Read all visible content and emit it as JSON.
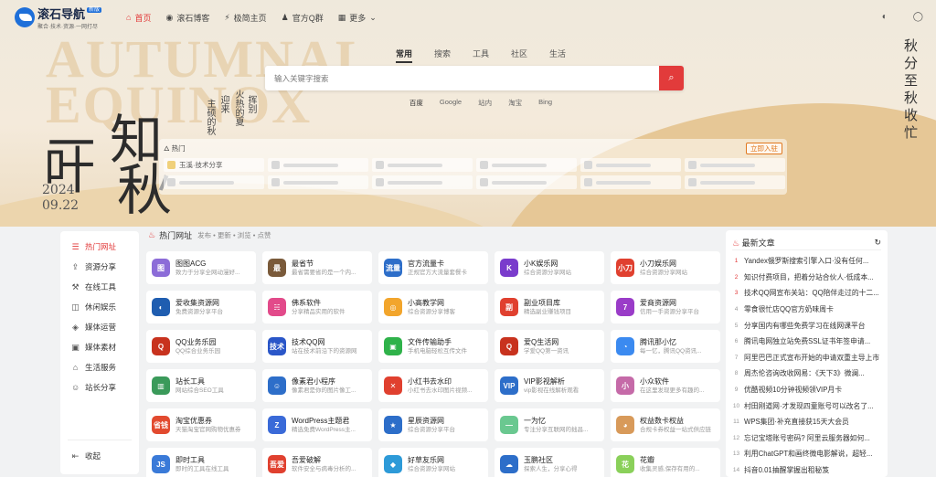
{
  "header": {
    "logo_title": "滚石导航",
    "logo_badge": "新版",
    "logo_slogan": "聚合·技术·资源·一网打尽",
    "nav": [
      {
        "label": "首页",
        "icon": "home-icon",
        "active": true
      },
      {
        "label": "滚石博客",
        "icon": "globe-icon",
        "active": false
      },
      {
        "label": "极简主页",
        "icon": "bolt-icon",
        "active": false
      },
      {
        "label": "官方Q群",
        "icon": "qq-penguin-icon",
        "active": false
      },
      {
        "label": "更多",
        "icon": "grid-icon",
        "active": false
      }
    ]
  },
  "hero": {
    "watermark": [
      "AUTUMNAL",
      "EQUINOX"
    ],
    "big_char_1": "一",
    "big_char_2": "叶",
    "big_char_3": "知",
    "big_char_4": "秋",
    "poem_col_1": "主硕的秋",
    "poem_col_2": "迎来",
    "poem_col_3": "火热的夏",
    "poem_col_4": "挥别",
    "year": "2024",
    "date": "09.22",
    "right_text_1": "秋分至",
    "right_text_2": "秋收忙"
  },
  "search": {
    "tabs": [
      "常用",
      "搜索",
      "工具",
      "社区",
      "生活"
    ],
    "active_tab": 0,
    "placeholder": "输入关键字搜索",
    "engines": [
      "百度",
      "Google",
      "站内",
      "淘宝",
      "Bing"
    ],
    "active_engine": 0
  },
  "hot": {
    "title": "热门",
    "join_label": "立即入驻",
    "first_item": "玉溪·技术分享"
  },
  "sidebar": {
    "items": [
      {
        "label": "热门网址",
        "icon": "list-icon",
        "active": true
      },
      {
        "label": "资源分享",
        "icon": "share-icon",
        "active": false
      },
      {
        "label": "在线工具",
        "icon": "tools-icon",
        "active": false
      },
      {
        "label": "休闲娱乐",
        "icon": "gamepad-icon",
        "active": false
      },
      {
        "label": "媒体运营",
        "icon": "layers-icon",
        "active": false
      },
      {
        "label": "媒体素材",
        "icon": "image-icon",
        "active": false
      },
      {
        "label": "生活服务",
        "icon": "store-icon",
        "active": false
      },
      {
        "label": "站长分享",
        "icon": "user-icon",
        "active": false
      }
    ],
    "collapse_label": "收起"
  },
  "section": {
    "title": "热门网址",
    "subtitle": "发布 • 更新 • 浏览 • 点赞"
  },
  "sites": [
    {
      "name": "图图ACG",
      "desc": "致力于分享全网动漫好...",
      "color": "#8c6cd8",
      "g": "图"
    },
    {
      "name": "最省节",
      "desc": "最省需要省的是一个内...",
      "color": "#7a5a3a",
      "g": "最"
    },
    {
      "name": "官方流量卡",
      "desc": "正规官方大流量套餐卡",
      "color": "#2d6ec9",
      "g": "流量"
    },
    {
      "name": "小K娱乐网",
      "desc": "综合资源分享网站",
      "color": "#7a3ccc",
      "g": "K"
    },
    {
      "name": "小刀娱乐网",
      "desc": "综合资源分享网站",
      "color": "#e0402f",
      "g": "小刀"
    },
    {
      "name": "爱收集资源网",
      "desc": "免费资源分享平台",
      "color": "#1f5db0",
      "g": "◐"
    },
    {
      "name": "佛系软件",
      "desc": "分享精品实用的软件",
      "color": "#e24a8a",
      "g": "☵"
    },
    {
      "name": "小高教学网",
      "desc": "综合资源分享博客",
      "color": "#f2a52c",
      "g": "◎"
    },
    {
      "name": "副业项目库",
      "desc": "精选副业赚钱项目",
      "color": "#e0402f",
      "g": "副"
    },
    {
      "name": "爱商资源网",
      "desc": "信用一手资源分享平台",
      "color": "#9a3cc8",
      "g": "7"
    },
    {
      "name": "QQ业务乐园",
      "desc": "QQ综合业务乐园",
      "color": "#c8321e",
      "g": "Q"
    },
    {
      "name": "技术QQ网",
      "desc": "站在技术前沿下的资源网",
      "color": "#2a56c8",
      "g": "技术"
    },
    {
      "name": "文件传输助手",
      "desc": "手机电脑轻松互传文件",
      "color": "#2fb24a",
      "g": "▣"
    },
    {
      "name": "爱Q生活网",
      "desc": "学爱QQ第一资讯",
      "color": "#c8321e",
      "g": "Q"
    },
    {
      "name": "腾讯那小忆",
      "desc": "每一忆，腾讯QQ资讯...",
      "color": "#3b8af0",
      "g": "◔"
    },
    {
      "name": "站长工具",
      "desc": "网站综合SEO工具",
      "color": "#3a9a5a",
      "g": "▥"
    },
    {
      "name": "像素君小程序",
      "desc": "像素君是你的图片像工...",
      "color": "#2d6ec9",
      "g": "☺"
    },
    {
      "name": "小红书去水印",
      "desc": "小红书去水印图片视频...",
      "color": "#e0402f",
      "g": "✕"
    },
    {
      "name": "VIP影视解析",
      "desc": "vip影视在线解析观看",
      "color": "#2d6ec9",
      "g": "VIP"
    },
    {
      "name": "小众软件",
      "desc": "在这里发现更多有趣的...",
      "color": "#c56aa8",
      "g": "小"
    },
    {
      "name": "淘宝优惠券",
      "desc": "天猫淘宝官网购物优惠券",
      "color": "#e24a2f",
      "g": "省钱"
    },
    {
      "name": "WordPress主题君",
      "desc": "精选免费WordPress主...",
      "color": "#3a6ad8",
      "g": "Z"
    },
    {
      "name": "星辰资源网",
      "desc": "综合资源分享平台",
      "color": "#2d6ec9",
      "g": "★"
    },
    {
      "name": "一为忆",
      "desc": "专注分享互联网的拙昌...",
      "color": "#6ac890",
      "g": "—"
    },
    {
      "name": "权益数卡权益",
      "desc": "合规卡券权益一站式供应链",
      "color": "#d89a5a",
      "g": "◕"
    },
    {
      "name": "即时工具",
      "desc": "即时的工具在线工具",
      "color": "#3a7ad8",
      "g": "JS"
    },
    {
      "name": "吾爱破解",
      "desc": "软件安全与病毒分析的...",
      "color": "#e0402f",
      "g": "吾爱"
    },
    {
      "name": "好草友乐网",
      "desc": "综合资源分享网站",
      "color": "#2d9ad8",
      "g": "◆"
    },
    {
      "name": "玉鹏社区",
      "desc": "探索人生，分享心得",
      "color": "#2d6ec9",
      "g": "☁"
    },
    {
      "name": "花瓣",
      "desc": "收集灵感,保存有用的...",
      "color": "#8ad05a",
      "g": "花"
    }
  ],
  "news": {
    "title": "最新文章",
    "items": [
      "Yandex俄罗斯搜索引擎入口·没有任何...",
      "知识付费项目，把着分站合伙人·低成本...",
      "技术QQ网宣布关站：QQ陪伴走过的十二...",
      "零食很忙店QQ官方奶味周卡",
      "分享国内有哪些免费学习在线网课平台",
      "腾讯电网独立站免费SSL证书年签申请...",
      "阿里巴巴正式宣布开始的申请双重主导上市",
      "周杰伦咨询改收网易：《天下3》微澜...",
      "优酷视频10分钟视频领VIP月卡",
      "村田刚道网·才发现四童账号可以改名了...",
      "WPS集团·补充直接获15天大会员",
      "忘记宝塔账号密码? 阿里云服务器如何...",
      "利用ChatGPT和画终微电影解说，超轻...",
      "抖音0.01抽醒掌握出租秘笈"
    ]
  }
}
